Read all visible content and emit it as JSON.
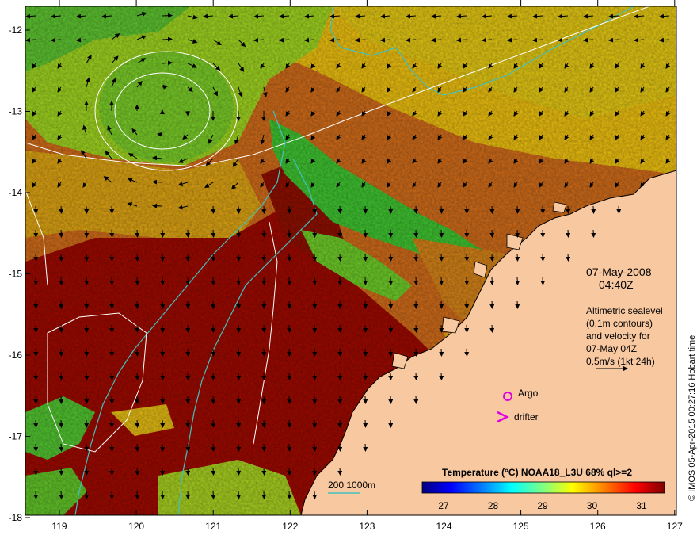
{
  "map": {
    "y_ticks": [
      "-12",
      "-13",
      "-14",
      "-15",
      "-16",
      "-17",
      "-18"
    ],
    "x_ticks": [
      "119",
      "120",
      "121",
      "122",
      "123",
      "124",
      "125",
      "126",
      "127"
    ],
    "date": "07-May-2008",
    "time": "04:40Z",
    "altimetry_lines": [
      "Altimetric sealevel",
      "(0.1m contours)",
      "and velocity for",
      "07-May 04Z",
      "0.5m/s (1kt 24h)"
    ],
    "argo_label": "Argo",
    "drifter_label": "drifter",
    "depth_legend": "200  1000m",
    "credit": "© IMOS 05-Apr-2015 00:27:16 Hobart time"
  },
  "colorbar": {
    "title": "Temperature (°C) NOAA18_L3U 68% ql>=2",
    "ticks": [
      "27",
      "28",
      "29",
      "30",
      "31"
    ],
    "colors": [
      "#00007f",
      "#0000ff",
      "#0080ff",
      "#00ffff",
      "#80ff80",
      "#ffff00",
      "#ff8000",
      "#ff0000",
      "#7f0000"
    ]
  },
  "colors": {
    "land": "#f8c8a0",
    "sst_hot": "#9b0a00",
    "sst_warm": "#c0501a",
    "sst_mid": "#e8b010",
    "sst_cool": "#8ad020",
    "sst_cold": "#30c030",
    "bathy": "#40c0c0",
    "contour": "#ffffff",
    "argo": "#e000e0"
  }
}
